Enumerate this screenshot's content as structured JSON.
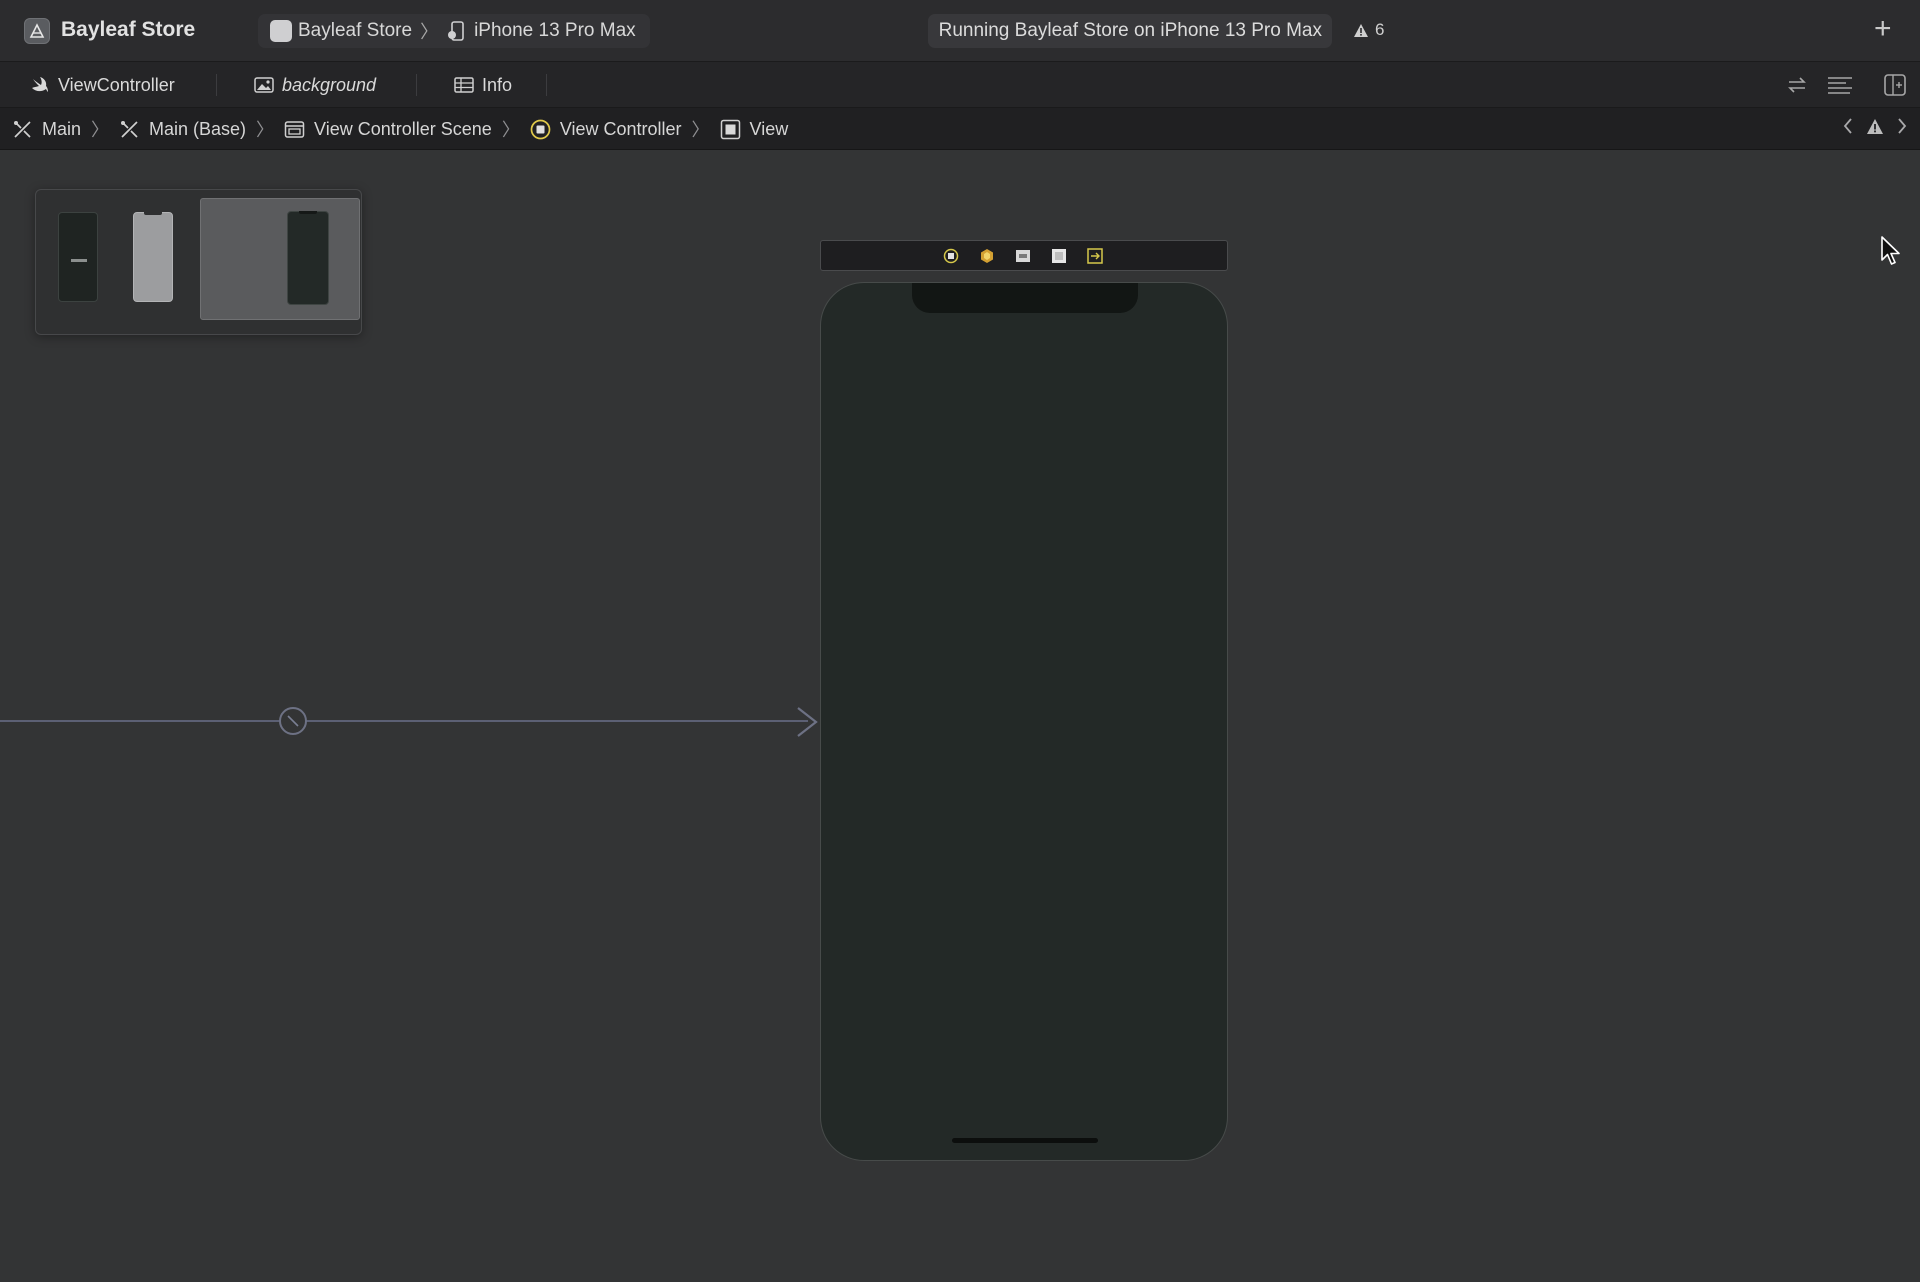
{
  "toolbar": {
    "app_title": "Bayleaf Store",
    "scheme_name": "Bayleaf Store",
    "device_name": "iPhone 13 Pro Max",
    "status_text": "Running Bayleaf Store on iPhone 13 Pro Max",
    "warning_count": "6",
    "add_label": "+"
  },
  "tabs": [
    {
      "label": "ViewController",
      "icon": "swift-icon"
    },
    {
      "label": "background",
      "icon": "image-asset-icon"
    },
    {
      "label": "Info",
      "icon": "table-icon"
    }
  ],
  "jumpbar": {
    "crumbs": [
      "Main",
      "Main (Base)",
      "View Controller Scene",
      "View Controller",
      "View"
    ]
  },
  "colors": {
    "canvas_bg": "#333435",
    "device_bg": "#232927",
    "toolbar_bg": "#2c2c2e",
    "entry_arrow": "#5c6074",
    "dock_icon_yellow": "#d6c84a"
  }
}
